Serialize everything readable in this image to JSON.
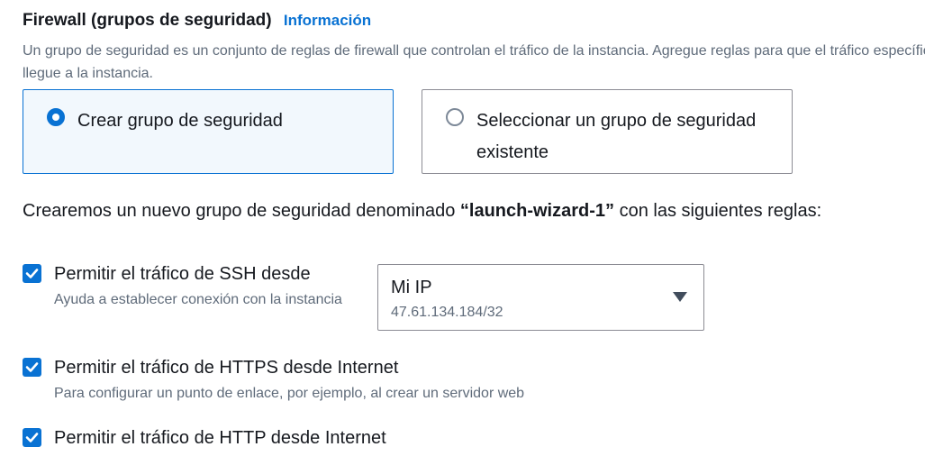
{
  "firewall": {
    "title": "Firewall (grupos de seguridad)",
    "info_link": "Información",
    "description": "Un grupo de seguridad es un conjunto de reglas de firewall que controlan el tráfico de la instancia. Agregue reglas para que el tráfico específico llegue a la instancia."
  },
  "options": {
    "create": {
      "label": "Crear grupo de seguridad",
      "selected": true
    },
    "existing": {
      "label": "Seleccionar un grupo de seguridad existente",
      "selected": false
    }
  },
  "rules_intro": {
    "prefix": "Crearemos un nuevo grupo de seguridad denominado ",
    "group_name": "“launch-wizard-1”",
    "suffix": " con las siguientes reglas:"
  },
  "rules": {
    "ssh": {
      "label": "Permitir el tráfico de SSH desde",
      "help": "Ayuda a establecer conexión con la instancia",
      "checked": true
    },
    "ssh_source": {
      "value": "Mi IP",
      "sub_value": "47.61.134.184/32"
    },
    "https": {
      "label": "Permitir el tráfico de HTTPS desde Internet",
      "help": "Para configurar un punto de enlace, por ejemplo, al crear un servidor web",
      "checked": true
    },
    "http": {
      "label": "Permitir el tráfico de HTTP desde Internet",
      "checked": true
    }
  },
  "colors": {
    "accent": "#0972d3",
    "text": "#16191f",
    "secondary_text": "#5f6b7a",
    "selected_tile_bg": "#f2f8fd",
    "border": "#8c8c94"
  },
  "icons": {
    "radio_selected": "radio-selected-icon",
    "radio_unselected": "radio-unselected-icon",
    "checkbox_checked": "checkmark-icon",
    "dropdown": "caret-down-icon"
  }
}
